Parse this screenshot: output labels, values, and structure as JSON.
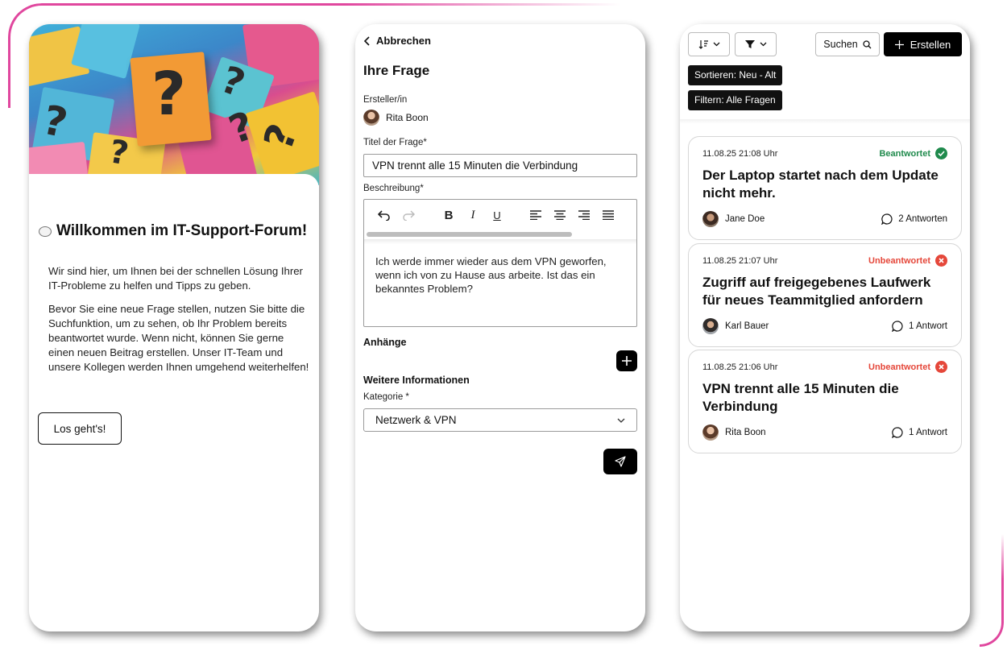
{
  "colors": {
    "brand_pink": "#e0479e",
    "answered_green": "#1f8a4c",
    "unanswered_red": "#e5473a",
    "black": "#000000"
  },
  "welcome_panel": {
    "hero_image": "question-mark-notes",
    "title": "Willkommen im IT-Support-Forum!",
    "intro": "Wir sind hier, um Ihnen bei der schnellen Lösung Ihrer IT-Probleme zu helfen und Tipps zu geben.",
    "body": "Bevor Sie eine neue Frage stellen, nutzen Sie bitte die Suchfunktion, um zu sehen, ob Ihr Problem bereits beantwortet wurde. Wenn nicht, können Sie gerne einen neuen Beitrag erstellen. Unser IT-Team und unsere Kollegen werden Ihnen umgehend weiterhelfen!",
    "start_button": "Los geht's!"
  },
  "question_form": {
    "cancel_label": "Abbrechen",
    "heading": "Ihre Frage",
    "author_label": "Ersteller/in",
    "author_name": "Rita Boon",
    "title_label": "Titel der Frage*",
    "title_value": "VPN trennt alle 15 Minuten die Verbindung",
    "description_label": "Beschreibung*",
    "description_value": "Ich werde immer wieder aus dem VPN geworfen, wenn ich von zu Hause aus arbeite. Ist das ein bekanntes Problem?",
    "toolbar": {
      "bold": "B",
      "italic": "I",
      "underline": "U"
    },
    "attachments_label": "Anhänge",
    "more_info_label": "Weitere Informationen",
    "category_label": "Kategorie *",
    "category_value": "Netzwerk & VPN"
  },
  "question_list": {
    "search_label": "Suchen",
    "create_label": "Erstellen",
    "sort_chip": "Sortieren: Neu - Alt",
    "filter_chip": "Filtern: Alle Fragen",
    "questions": [
      {
        "date": "11.08.25 21:08 Uhr",
        "status": "Beantwortet",
        "answered": true,
        "title": "Der Laptop startet nach dem Update nicht mehr.",
        "author": "Jane Doe",
        "replies": "2 Antworten"
      },
      {
        "date": "11.08.25 21:07 Uhr",
        "status": "Unbeantwortet",
        "answered": false,
        "title": "Zugriff auf freigegebenes Laufwerk für neues Teammitglied anfordern",
        "author": "Karl Bauer",
        "replies": "1 Antwort"
      },
      {
        "date": "11.08.25 21:06 Uhr",
        "status": "Unbeantwortet",
        "answered": false,
        "title": "VPN trennt alle 15 Minuten die Verbindung",
        "author": "Rita Boon",
        "replies": "1 Antwort"
      }
    ]
  }
}
